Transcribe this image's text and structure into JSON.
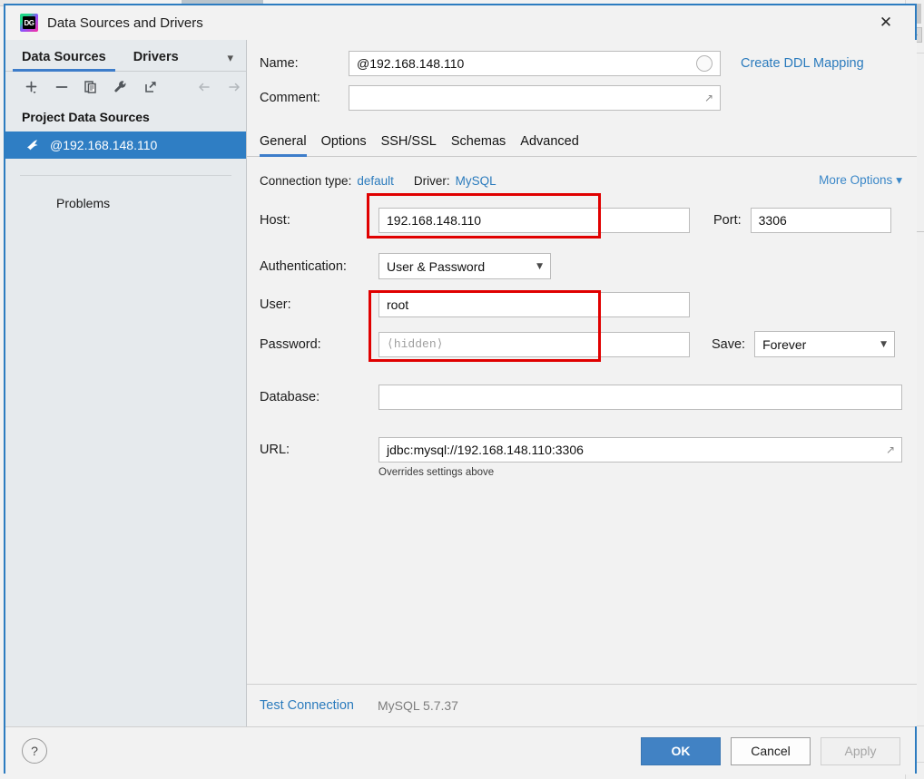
{
  "window": {
    "title": "Data Sources and Drivers",
    "app_icon": "datagrip-icon",
    "close_label": "✕"
  },
  "sidebar": {
    "tabs": [
      {
        "label": "Data Sources",
        "active": true
      },
      {
        "label": "Drivers",
        "active": false
      }
    ],
    "tabs_overflow_icon": "chevron-down-icon",
    "toolbar": [
      {
        "name": "add-button",
        "icon": "plus-icon",
        "enabled": true
      },
      {
        "name": "remove-button",
        "icon": "minus-icon",
        "enabled": true
      },
      {
        "name": "duplicate-button",
        "icon": "copy-icon",
        "enabled": true
      },
      {
        "name": "properties-button",
        "icon": "wrench-icon",
        "enabled": true
      },
      {
        "name": "open-button",
        "icon": "external-link-icon",
        "enabled": true
      },
      {
        "name": "back-button",
        "icon": "arrow-left-icon",
        "enabled": false
      },
      {
        "name": "forward-button",
        "icon": "arrow-right-icon",
        "enabled": false
      }
    ],
    "group_header": "Project Data Sources",
    "data_source": {
      "label": "@192.168.148.110",
      "icon": "mysql-dolphin-icon",
      "selected": true
    },
    "problems_label": "Problems"
  },
  "form": {
    "name_label": "Name:",
    "name_value": "@192.168.148.110",
    "name_color_icon": "color-circle-icon",
    "create_ddl_mapping": "Create DDL Mapping",
    "comment_label": "Comment:",
    "comment_value": "",
    "comment_expand_icon": "expand-icon"
  },
  "tabs": [
    {
      "label": "General",
      "active": true
    },
    {
      "label": "Options",
      "active": false
    },
    {
      "label": "SSH/SSL",
      "active": false
    },
    {
      "label": "Schemas",
      "active": false
    },
    {
      "label": "Advanced",
      "active": false
    }
  ],
  "general": {
    "connection_type_label": "Connection type:",
    "connection_type_value": "default",
    "driver_label": "Driver:",
    "driver_value": "MySQL",
    "more_options": "More Options",
    "more_options_icon": "chevron-down-icon",
    "host_label": "Host:",
    "host_value": "192.168.148.110",
    "port_label": "Port:",
    "port_value": "3306",
    "authentication_label": "Authentication:",
    "authentication_value": "User & Password",
    "user_label": "User:",
    "user_value": "root",
    "password_label": "Password:",
    "password_placeholder": "⟨hidden⟩",
    "save_label": "Save:",
    "save_value": "Forever",
    "database_label": "Database:",
    "database_value": "",
    "url_label": "URL:",
    "url_value": "jdbc:mysql://192.168.148.110:3306",
    "url_expand_icon": "expand-icon",
    "url_note": "Overrides settings above"
  },
  "status": {
    "test_connection": "Test Connection",
    "driver_version": "MySQL 5.7.37"
  },
  "footer": {
    "help_label": "?",
    "ok_label": "OK",
    "cancel_label": "Cancel",
    "apply_label": "Apply",
    "apply_enabled": false
  },
  "annotations": {
    "highlight_color": "#e00000",
    "boxes": [
      {
        "name": "host-field-highlight",
        "target": "host-input"
      },
      {
        "name": "credentials-highlight",
        "target": "user-and-password-inputs"
      }
    ]
  },
  "colors": {
    "accent": "#2f7ec4",
    "link": "#2b7bbd",
    "dialog_border": "#2d7cc0",
    "selection": "#2f7ec4",
    "annotation": "#e00000"
  }
}
